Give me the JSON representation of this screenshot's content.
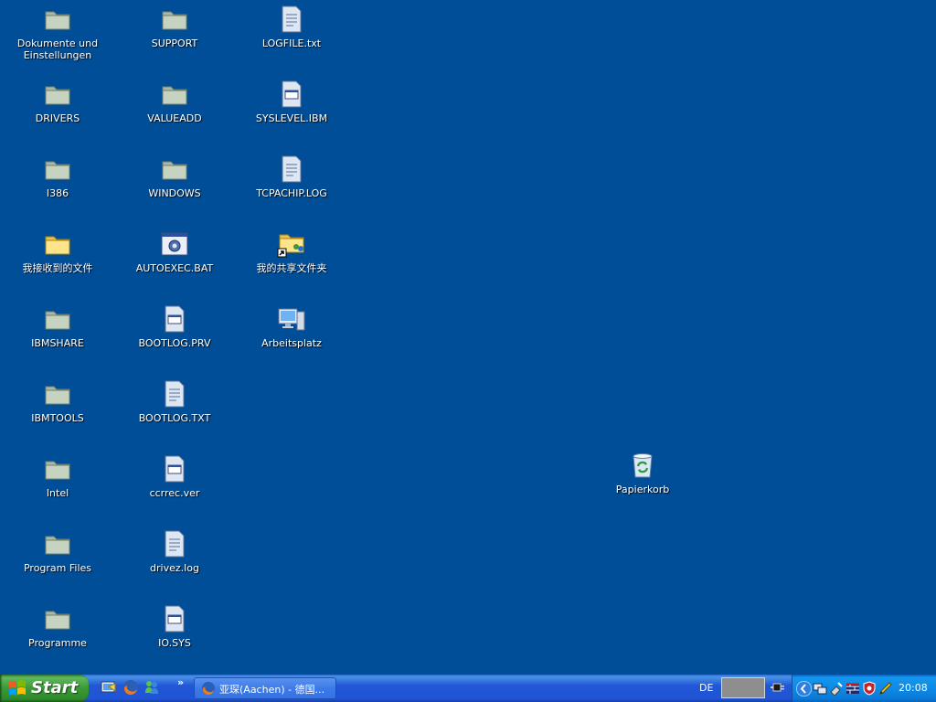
{
  "desktop": {
    "background": "#004e98",
    "icons": {
      "dokumente": "Dokumente und Einstellungen",
      "drivers": "DRIVERS",
      "i386": "I386",
      "received_files": "我接收到的文件",
      "ibmshare": "IBMSHARE",
      "ibmtools": "IBMTOOLS",
      "intel": "Intel",
      "program_files": "Program Files",
      "programme": "Programme",
      "support": "SUPPORT",
      "valueadd": "VALUEADD",
      "windows": "WINDOWS",
      "autoexec": "AUTOEXEC.BAT",
      "bootlog_prv": "BOOTLOG.PRV",
      "bootlog_txt": "BOOTLOG.TXT",
      "ccrrec": "ccrrec.ver",
      "drivez": "drivez.log",
      "iosys": "IO.SYS",
      "logfile": "LOGFILE.txt",
      "syslevel": "SYSLEVEL.IBM",
      "tcpachip": "TCPACHIP.LOG",
      "shared_folder": "我的共享文件夹",
      "arbeitsplatz": "Arbeitsplatz",
      "papierkorb": "Papierkorb"
    }
  },
  "taskbar": {
    "start_label": "Start",
    "quick_launch": [
      "show-desktop-icon",
      "firefox-icon",
      "messenger-icon"
    ],
    "chevron": "»",
    "task_button_label": "亚琛(Aachen) - 德国...",
    "language": "DE",
    "clock": "20:08"
  },
  "colors": {
    "desktop": "#004e98",
    "taskbar": "#2157d7",
    "start_button": "#3a9a36",
    "tray": "#0d8be6"
  }
}
